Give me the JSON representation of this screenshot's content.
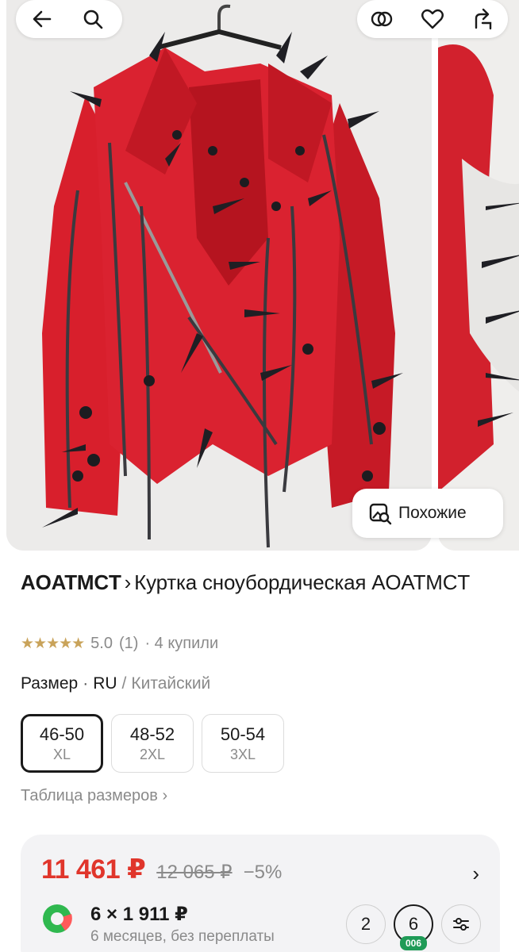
{
  "gallery": {
    "similar_label": "Похожие"
  },
  "product": {
    "brand": "AOATMCT",
    "title_rest": "Куртка сноубордическая AOATMCT",
    "stars": "★★★★★",
    "rating": "5.0",
    "reviews": "(1)",
    "bought": "· 4 купили"
  },
  "size": {
    "label": "Размер",
    "dot": "·",
    "system_active": "RU",
    "system_sep": "/",
    "system_other": "Китайский",
    "options": [
      {
        "num": "46-50",
        "lab": "XL"
      },
      {
        "num": "48-52",
        "lab": "2XL"
      },
      {
        "num": "50-54",
        "lab": "3XL"
      }
    ],
    "table_link": "Таблица размеров ›"
  },
  "price": {
    "current": "11 461 ₽",
    "old": "12 065 ₽",
    "discount": "−5%",
    "arrow": "›",
    "split_amount": "6 × 1 911 ₽",
    "split_terms": "6 месяцев, без переплаты",
    "months": [
      "2",
      "6"
    ],
    "months_badge": "006",
    "settings_icon": "sliders-icon"
  },
  "colors": {
    "accent_red": "#e0352b",
    "stars": "#c9a35a",
    "jacket_red": "#d81f2c",
    "badge_green": "#1f9b57"
  }
}
